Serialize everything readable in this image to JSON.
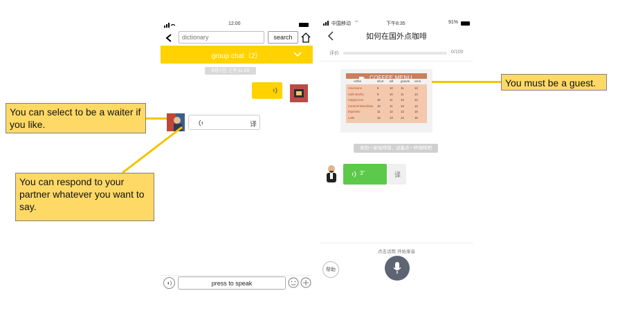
{
  "callouts": {
    "waiter": "You can select to be a waiter if you like.",
    "respond": "You can respond to your partner whatever you want to say.",
    "guest": "You must be a guest."
  },
  "left_phone": {
    "status": {
      "time": "12:00"
    },
    "search": {
      "placeholder": "dictionary",
      "button": "search"
    },
    "group_bar": {
      "title": "group chat（2）"
    },
    "timestamp": "6月7日 上午11:55",
    "incoming": {
      "translate": "译"
    },
    "bottom": {
      "speak": "press to speak"
    }
  },
  "right_phone": {
    "status": {
      "carrier": "中国移动",
      "time": "下午8:35",
      "battery": "91%"
    },
    "nav": {
      "title": "如何在国外点咖啡"
    },
    "rating": {
      "label": "评价",
      "value": "0/100",
      "progress": 0
    },
    "menu": {
      "title": "COFFEE MENU",
      "headers": [
        "coffee",
        "short",
        "tall",
        "grande",
        "venti"
      ],
      "rows": [
        [
          "Americano",
          "8",
          "10",
          "11",
          "13"
        ],
        [
          "Café Mocha",
          "9",
          "10",
          "11",
          "13"
        ],
        [
          "Cappuccino",
          "10",
          "11",
          "13",
          "14"
        ],
        [
          "Caramel Macchiato",
          "10",
          "11",
          "13",
          "14"
        ],
        [
          "Espresso",
          "11",
          "12",
          "13",
          "15"
        ],
        [
          "Latte",
          "12",
          "13",
          "14",
          "16"
        ]
      ]
    },
    "system_message": "来到一家咖啡馆，试着点一杯咖啡吧",
    "voice": {
      "duration": "3''",
      "translate": "译"
    },
    "hint": "点击话筒 开始录音",
    "help": "帮助"
  },
  "colors": {
    "yellow": "#ffd200",
    "green": "#5cc94a",
    "callout": "#ffd966",
    "line": "#f5c400"
  }
}
